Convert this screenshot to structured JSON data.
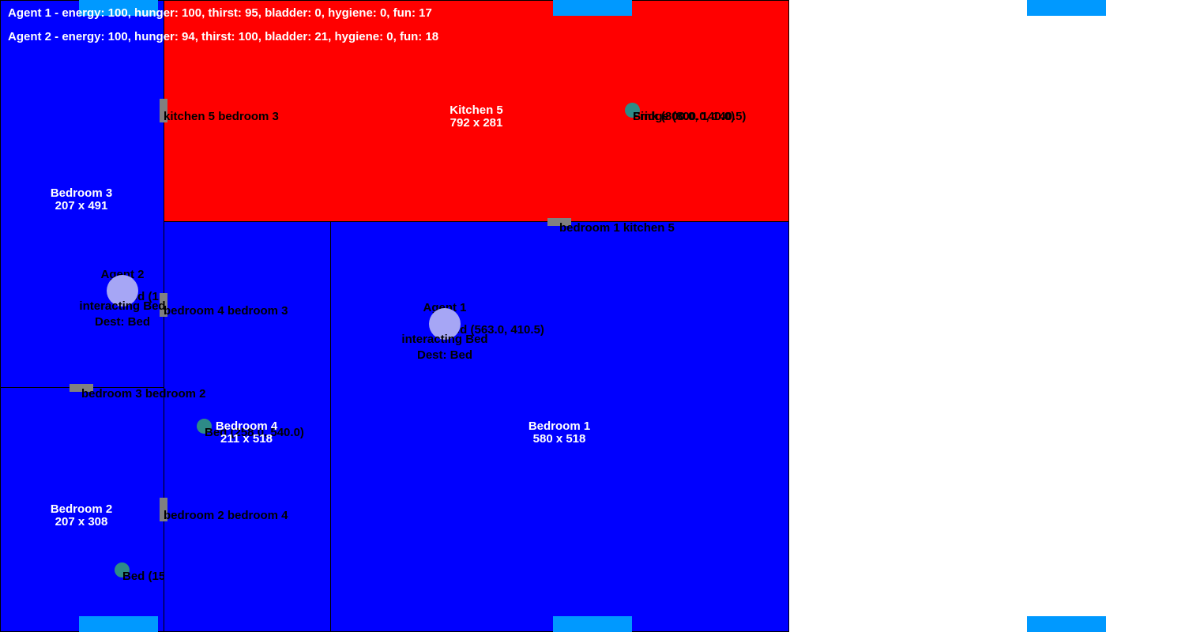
{
  "colors": {
    "bedroom": "#0000ff",
    "kitchen": "#ff0000",
    "door": "#808080",
    "object": "#2e8b87",
    "agent": "#a6a6f5",
    "window_marker": "#0099ff"
  },
  "status": {
    "agent1": "Agent 1 - energy: 100, hunger: 100, thirst: 95, bladder: 0, hygiene: 0, fun: 17",
    "agent2": "Agent 2 - energy: 100, hunger: 94, thirst: 100, bladder: 21, hygiene: 0, fun: 18"
  },
  "rooms": {
    "kitchen5": {
      "name": "Kitchen 5",
      "size": "792 x 281"
    },
    "bedroom3": {
      "name": "Bedroom 3",
      "size": "207 x 491"
    },
    "bedroom2": {
      "name": "Bedroom 2",
      "size": "207 x 308"
    },
    "bedroom4": {
      "name": "Bedroom 4",
      "size": "211 x 518"
    },
    "bedroom1": {
      "name": "Bedroom 1",
      "size": "580 x 518"
    }
  },
  "doors": {
    "kitchen5_bedroom3": "kitchen 5 bedroom 3",
    "bedroom1_kitchen5": "bedroom 1 kitchen 5",
    "bedroom4_bedroom3": "bedroom 4 bedroom 3",
    "bedroom3_bedroom2": "bedroom 3 bedroom 2",
    "bedroom2_bedroom4": "bedroom 2 bedroom 4"
  },
  "objects": {
    "sink": "Sink (800.0, 140.0)",
    "fridge": "Fridge (800.0, 140.5)",
    "bed_bedroom4": "Bed (258.0, 540.0)",
    "bed_bedroom2": "Bed (155.0, 722.0)",
    "bed_bedroom3_partial": "Bed (1",
    "bed_bedroom1": "Bed (563.0, 410.5)"
  },
  "agents": {
    "agent1": {
      "name": "Agent 1",
      "action": "interacting Bed",
      "dest": "Dest: Bed"
    },
    "agent2": {
      "name": "Agent 2",
      "action": "interacting Bed",
      "dest": "Dest: Bed"
    }
  }
}
